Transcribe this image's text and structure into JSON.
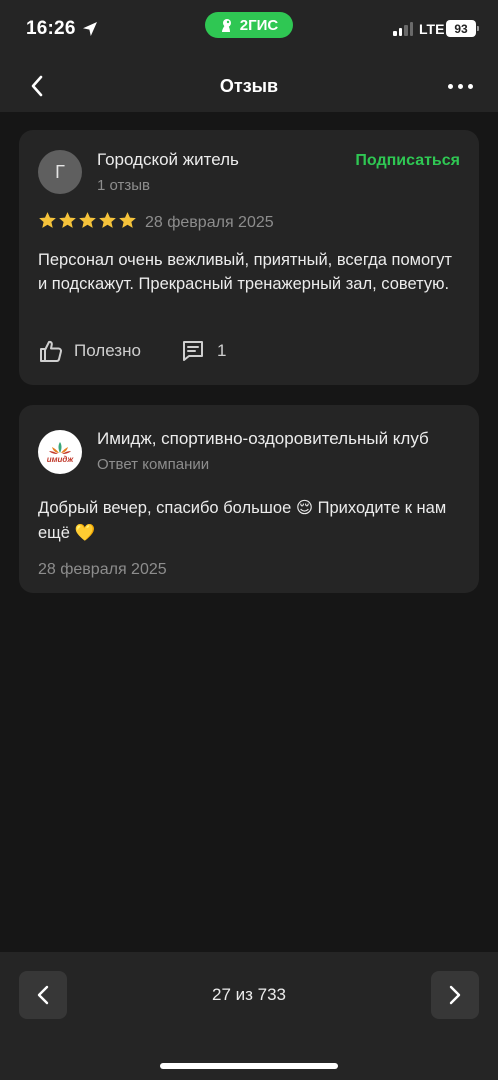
{
  "status_bar": {
    "time": "16:26",
    "app_badge": "2ГИС",
    "network": "LTE",
    "battery": "93"
  },
  "header": {
    "title": "Отзыв",
    "back_icon": "chevron-left-icon",
    "more_icon": "more-horizontal-icon"
  },
  "review": {
    "avatar_letter": "Г",
    "author": "Городской житель",
    "author_reviews": "1 отзыв",
    "subscribe_label": "Подписаться",
    "rating": 5,
    "date": "28 февраля 2025",
    "text": "Персонал очень вежливый, приятный, всегда помогут и подскажут. Прекрасный тренажерный зал, советую.",
    "useful_label": "Полезно",
    "comments_count": "1"
  },
  "company_reply": {
    "logo_text": "имидж",
    "name": "Имидж, спортивно-оздоровительный клуб",
    "subtitle": "Ответ компании",
    "text": "Добрый вечер, спасибо большое 😌 Приходите к нам ещё 💛",
    "date": "28 февраля 2025"
  },
  "pagination": {
    "label": "27 из 733"
  },
  "colors": {
    "accent": "#2fc753",
    "star": "#f5c33b",
    "card": "#252525",
    "background": "#161616"
  }
}
